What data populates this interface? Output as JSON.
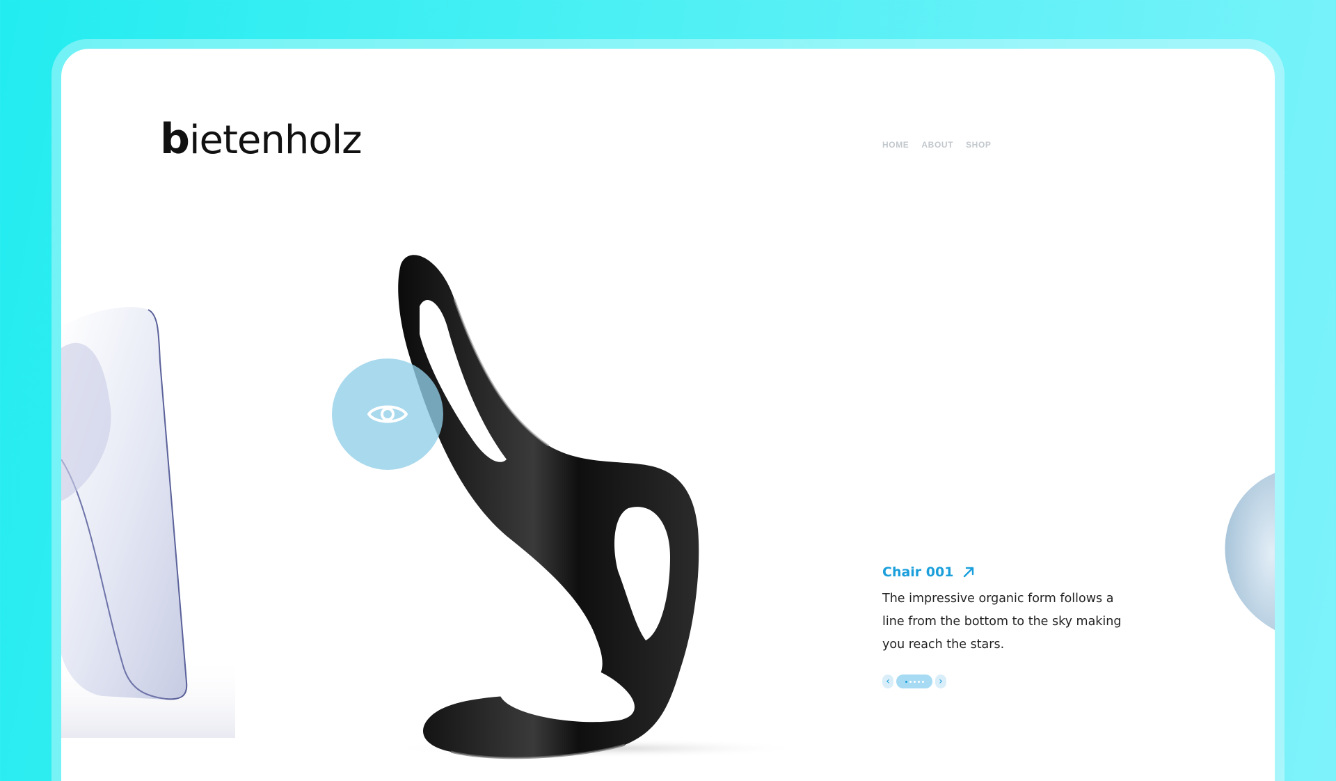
{
  "brand": {
    "logo_bold": "b",
    "logo_rest": "ietenholz"
  },
  "nav": {
    "items": [
      "HOME",
      "ABOUT",
      "SHOP"
    ]
  },
  "product": {
    "title": "Chair 001",
    "description": "The impressive organic form follows a line from the bottom to the sky making you reach the stars.",
    "pager": {
      "prev_icon": "‹",
      "next_icon": "›",
      "total_dots": 5,
      "active_dot": 1
    }
  },
  "icons": {
    "view": "eye-icon",
    "link": "arrow-up-right-icon"
  },
  "colors": {
    "background_gradient_start": "#22ecf0",
    "background_gradient_end": "#7ef2fb",
    "accent": "#1a9fdb",
    "view_button": "#91cee8",
    "nav_text": "#c2c7cc"
  }
}
